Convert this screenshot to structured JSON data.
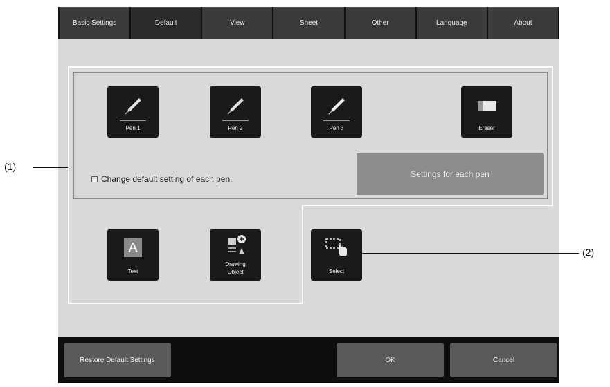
{
  "tabs": [
    {
      "label": "Basic Settings"
    },
    {
      "label": "Default"
    },
    {
      "label": "View"
    },
    {
      "label": "Sheet"
    },
    {
      "label": "Other"
    },
    {
      "label": "Language"
    },
    {
      "label": "About"
    }
  ],
  "active_tab": "Default",
  "pens": [
    {
      "label": "Pen 1",
      "icon": "pen-icon"
    },
    {
      "label": "Pen 2",
      "icon": "pen-icon"
    },
    {
      "label": "Pen 3",
      "icon": "pen-icon"
    },
    {
      "label": "Eraser",
      "icon": "eraser-icon"
    }
  ],
  "checkbox": {
    "label": "Change default setting of each pen.",
    "checked": false
  },
  "settings_button": "Settings for each pen",
  "tools": [
    {
      "label": "Text",
      "icon": "text-icon"
    },
    {
      "label_line1": "Drawing",
      "label_line2": "Object",
      "icon": "drawing-object-icon"
    },
    {
      "label": "Select",
      "icon": "select-icon"
    }
  ],
  "buttons": {
    "restore": "Restore Default Settings",
    "ok": "OK",
    "cancel": "Cancel"
  },
  "callouts": {
    "one": "(1)",
    "two": "(2)"
  }
}
